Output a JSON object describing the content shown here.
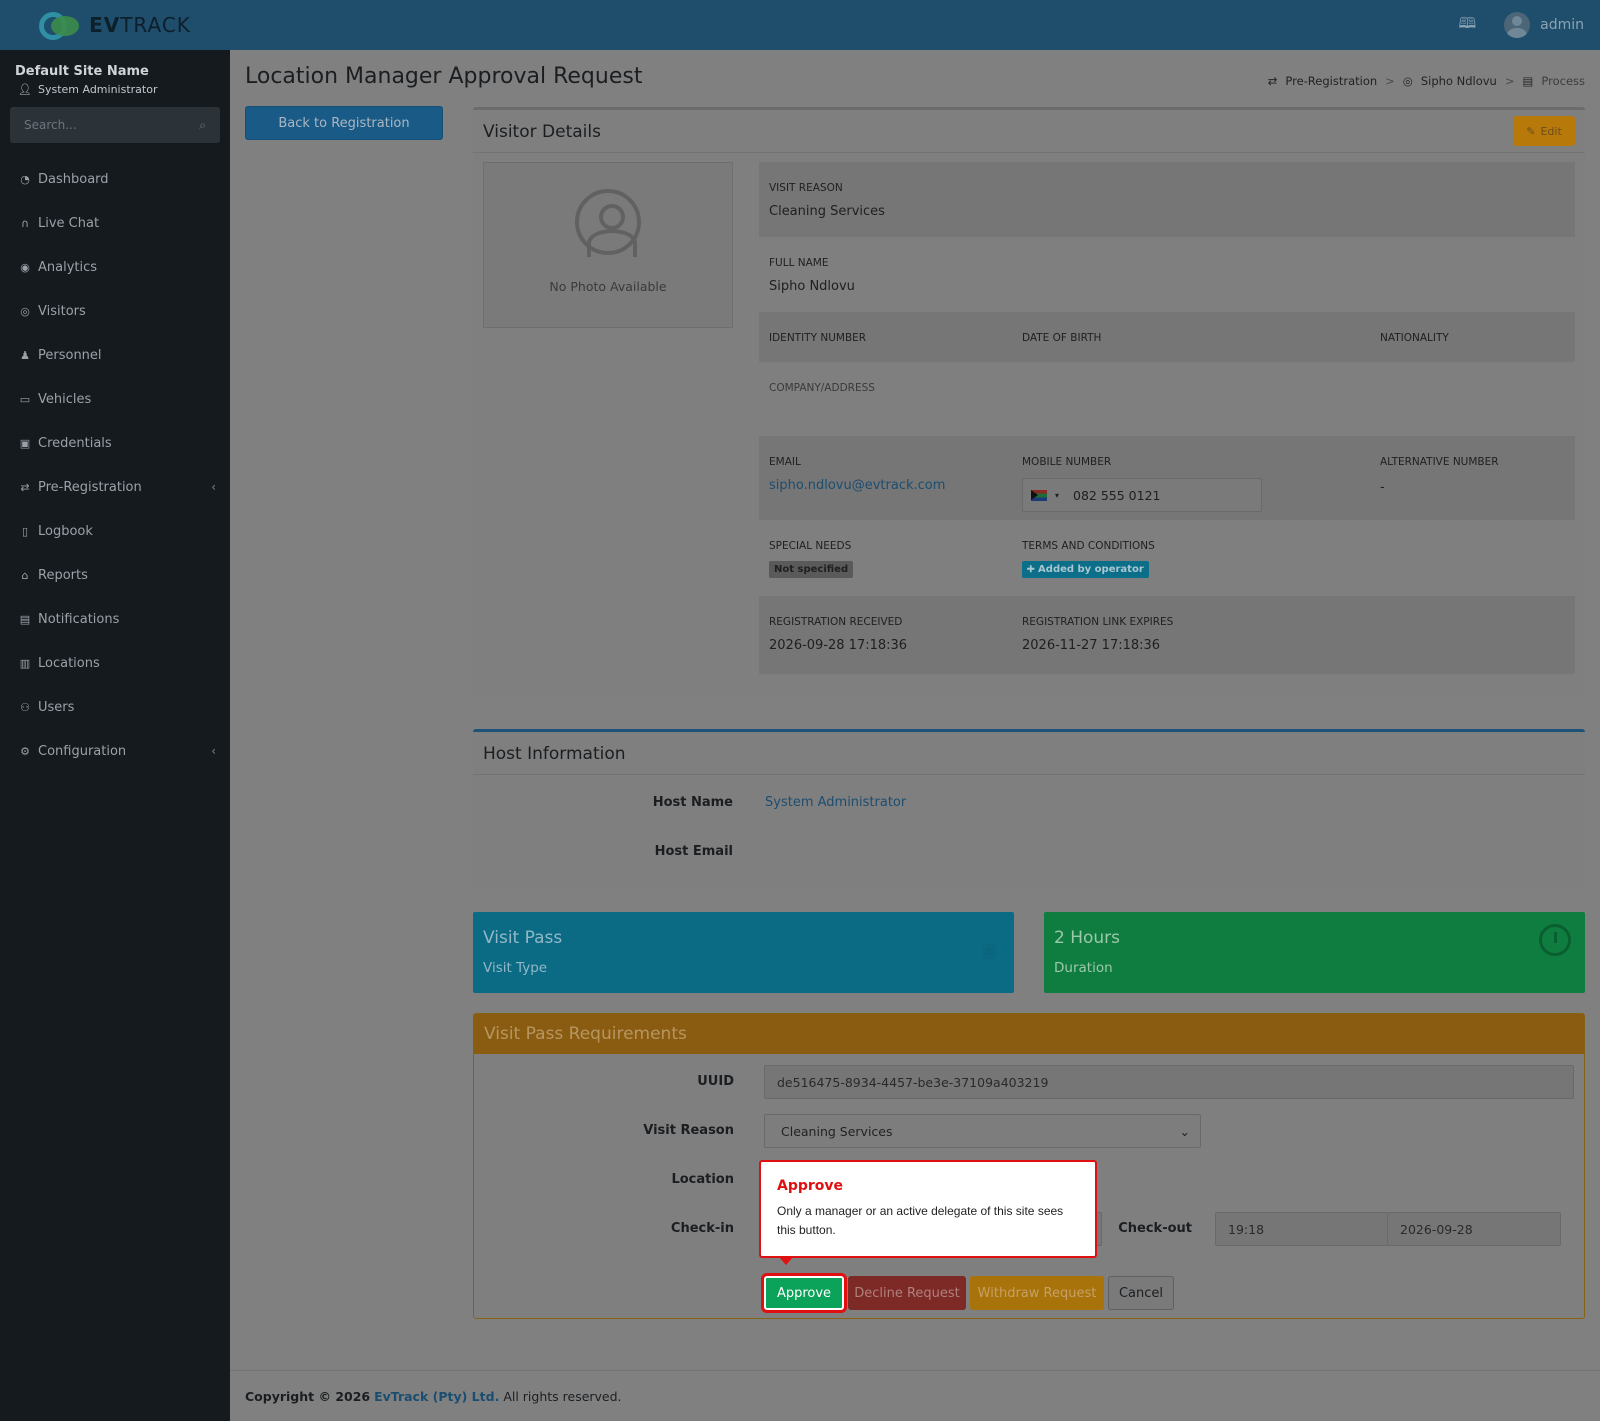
{
  "brand": {
    "name_bold": "EV",
    "name_rest": "TRACK"
  },
  "topbar": {
    "user": "admin",
    "logbook_icon": "book-icon"
  },
  "sidebar": {
    "site_name": "Default Site Name",
    "role": "System Administrator",
    "search_placeholder": "Search...",
    "items": [
      {
        "label": "Dashboard",
        "icon": "gauge-icon"
      },
      {
        "label": "Live Chat",
        "icon": "headset-icon"
      },
      {
        "label": "Analytics",
        "icon": "target-icon"
      },
      {
        "label": "Visitors",
        "icon": "eye-icon"
      },
      {
        "label": "Personnel",
        "icon": "user-gear-icon"
      },
      {
        "label": "Vehicles",
        "icon": "car-icon"
      },
      {
        "label": "Credentials",
        "icon": "badge-icon"
      },
      {
        "label": "Pre-Registration",
        "icon": "arrows-icon",
        "has_children": true
      },
      {
        "label": "Logbook",
        "icon": "book-icon"
      },
      {
        "label": "Reports",
        "icon": "chart-icon"
      },
      {
        "label": "Notifications",
        "icon": "bell-icon"
      },
      {
        "label": "Locations",
        "icon": "map-icon"
      },
      {
        "label": "Users",
        "icon": "users-icon"
      },
      {
        "label": "Configuration",
        "icon": "gear-icon",
        "has_children": true
      }
    ]
  },
  "page": {
    "title": "Location Manager Approval Request",
    "back_button": "Back to Registration",
    "breadcrumb": [
      "Pre-Registration",
      "Sipho Ndlovu",
      "Process"
    ]
  },
  "visitor": {
    "card_title": "Visitor Details",
    "edit_label": "Edit",
    "no_photo": "No Photo Available",
    "visit_reason_label": "VISIT REASON",
    "visit_reason": "Cleaning Services",
    "full_name_label": "FULL NAME",
    "full_name": "Sipho Ndlovu",
    "identity_label": "IDENTITY NUMBER",
    "dob_label": "DATE OF BIRTH",
    "nationality_label": "NATIONALITY",
    "company_label": "COMPANY/ADDRESS",
    "email_label": "EMAIL",
    "email": "sipho.ndlovu@evtrack.com",
    "mobile_label": "MOBILE NUMBER",
    "mobile": "082 555 0121",
    "alt_label": "ALTERNATIVE NUMBER",
    "alt_value": "-",
    "special_label": "SPECIAL NEEDS",
    "special_value": "Not specified",
    "terms_label": "TERMS AND CONDITIONS",
    "terms_value": "Added by operator",
    "received_label": "REGISTRATION RECEIVED",
    "received": "2026-09-28 17:18:36",
    "expires_label": "REGISTRATION LINK EXPIRES",
    "expires": "2026-11-27 17:18:36"
  },
  "host": {
    "card_title": "Host Information",
    "name_label": "Host Name",
    "name": "System Administrator",
    "email_label": "Host Email"
  },
  "pass": {
    "title": "Visit Pass",
    "subtitle": "Visit Type",
    "duration_title": "2 Hours",
    "duration_subtitle": "Duration"
  },
  "requirements": {
    "card_title": "Visit Pass Requirements",
    "uuid_label": "UUID",
    "uuid": "de516475-8934-4457-be3e-37109a403219",
    "reason_label": "Visit Reason",
    "reason": "Cleaning Services",
    "location_label": "Location",
    "checkin_label": "Check-in",
    "checkout_label": "Check-out",
    "checkout_time": "19:18",
    "checkout_date": "2026-09-28",
    "approve": "Approve",
    "decline": "Decline Request",
    "withdraw": "Withdraw Request",
    "cancel": "Cancel"
  },
  "tooltip": {
    "title": "Approve",
    "body": "Only a manager or an active delegate of this site sees this button."
  },
  "footer": {
    "prefix": "Copyright © 2026",
    "company": "EvTrack (Pty) Ltd.",
    "suffix": "All rights reserved."
  }
}
